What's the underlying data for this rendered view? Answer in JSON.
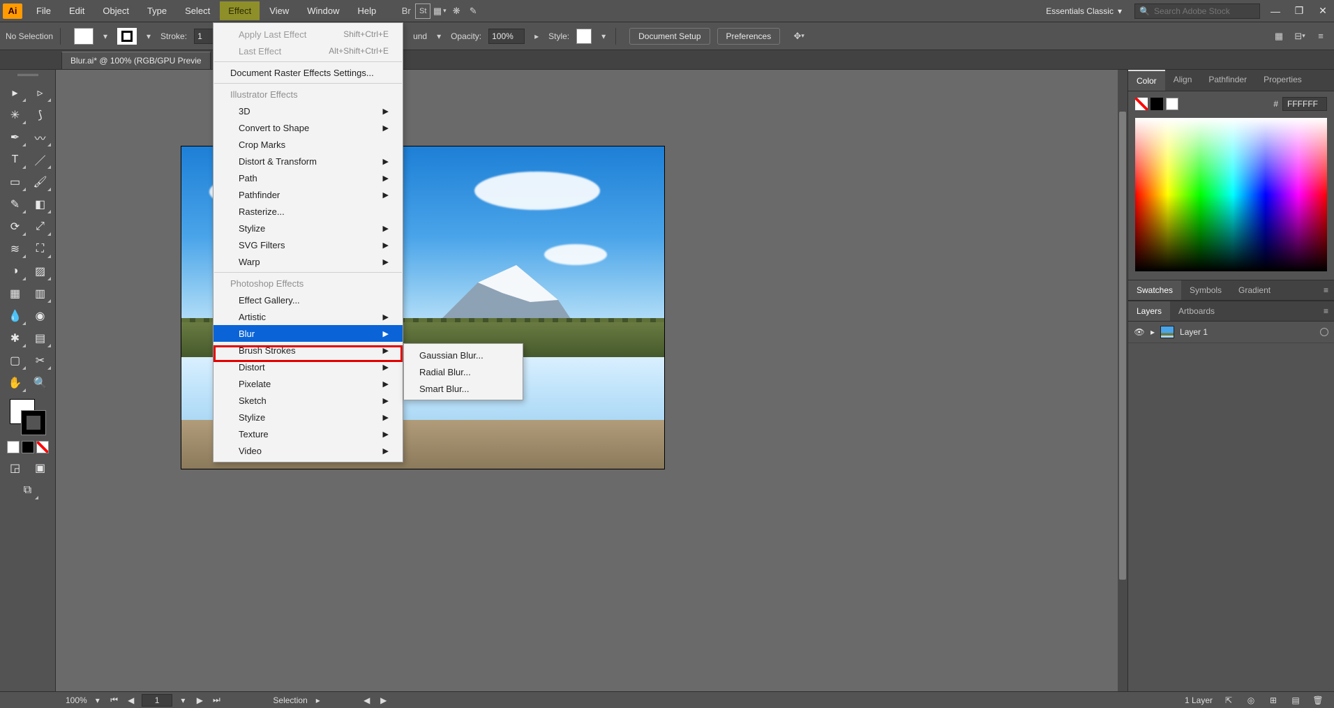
{
  "app": {
    "logo_text": "Ai"
  },
  "menubar": {
    "items": [
      "File",
      "Edit",
      "Object",
      "Type",
      "Select",
      "Effect",
      "View",
      "Window",
      "Help"
    ],
    "active_index": 5,
    "workspace_label": "Essentials Classic",
    "search_placeholder": "Search Adobe Stock"
  },
  "controlbar": {
    "selection_state": "No Selection",
    "stroke_label": "Stroke:",
    "stroke_value": "1",
    "mid_label_trunc": "und",
    "opacity_label": "Opacity:",
    "opacity_value": "100%",
    "style_label": "Style:",
    "doc_setup": "Document Setup",
    "preferences": "Preferences"
  },
  "document_tab": "Blur.ai* @ 100% (RGB/GPU Previe",
  "effect_menu": {
    "apply_last": "Apply Last Effect",
    "apply_last_sc": "Shift+Ctrl+E",
    "last_effect": "Last Effect",
    "last_effect_sc": "Alt+Shift+Ctrl+E",
    "raster_settings": "Document Raster Effects Settings...",
    "hdr_illustrator": "Illustrator Effects",
    "three_d": "3D",
    "convert_shape": "Convert to Shape",
    "crop_marks": "Crop Marks",
    "distort_transform": "Distort & Transform",
    "path": "Path",
    "pathfinder": "Pathfinder",
    "rasterize": "Rasterize...",
    "stylize_i": "Stylize",
    "svg_filters": "SVG Filters",
    "warp": "Warp",
    "hdr_photoshop": "Photoshop Effects",
    "effect_gallery": "Effect Gallery...",
    "artistic": "Artistic",
    "blur": "Blur",
    "brush_strokes": "Brush Strokes",
    "distort": "Distort",
    "pixelate": "Pixelate",
    "sketch": "Sketch",
    "stylize_p": "Stylize",
    "texture": "Texture",
    "video": "Video"
  },
  "blur_submenu": {
    "gaussian": "Gaussian Blur...",
    "radial": "Radial Blur...",
    "smart": "Smart Blur..."
  },
  "panels": {
    "color_tabs": [
      "Color",
      "Align",
      "Pathfinder",
      "Properties"
    ],
    "color_active": 0,
    "hex_prefix": "#",
    "hex_value": "FFFFFF",
    "swatches_tabs": [
      "Swatches",
      "Symbols",
      "Gradient"
    ],
    "swatches_active": 0,
    "layers_tabs": [
      "Layers",
      "Artboards"
    ],
    "layers_active": 0,
    "layer_name": "Layer 1"
  },
  "statusbar": {
    "zoom": "100%",
    "artboard_nav": "1",
    "center_label": "Selection",
    "layer_count": "1 Layer"
  }
}
